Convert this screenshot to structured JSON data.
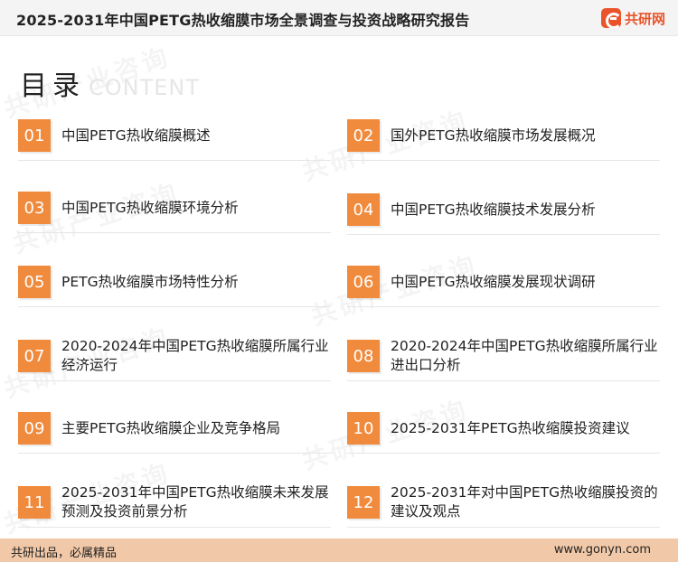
{
  "header": {
    "title": "2025-2031年中国PETG热收缩膜市场全景调查与投资战略研究报告",
    "logo_text": "共研网",
    "logo_icon": "brand-logo-icon"
  },
  "toc": {
    "title": "目录",
    "subtitle": "CONTENT",
    "items": [
      {
        "num": "01",
        "label": "中国PETG热收缩膜概述"
      },
      {
        "num": "02",
        "label": "国外PETG热收缩膜市场发展概况"
      },
      {
        "num": "03",
        "label": "中国PETG热收缩膜环境分析"
      },
      {
        "num": "04",
        "label": "中国PETG热收缩膜技术发展分析"
      },
      {
        "num": "05",
        "label": "PETG热收缩膜市场特性分析"
      },
      {
        "num": "06",
        "label": "中国PETG热收缩膜发展现状调研"
      },
      {
        "num": "07",
        "label": "2020-2024年中国PETG热收缩膜所属行业经济运行"
      },
      {
        "num": "08",
        "label": "2020-2024年中国PETG热收缩膜所属行业进出口分析"
      },
      {
        "num": "09",
        "label": "主要PETG热收缩膜企业及竞争格局"
      },
      {
        "num": "10",
        "label": "2025-2031年PETG热收缩膜投资建议"
      },
      {
        "num": "11",
        "label": "2025-2031年中国PETG热收缩膜未来发展预测及投资前景分析"
      },
      {
        "num": "12",
        "label": "2025-2031年对中国PETG热收缩膜投资的建议及观点"
      }
    ]
  },
  "footer": {
    "slogan": "共研出品，必属精品",
    "url": "www.gonyn.com"
  },
  "colors": {
    "accent": "#f08a3c",
    "brand": "#e9542a",
    "footer_bg": "#f2c9a8"
  }
}
